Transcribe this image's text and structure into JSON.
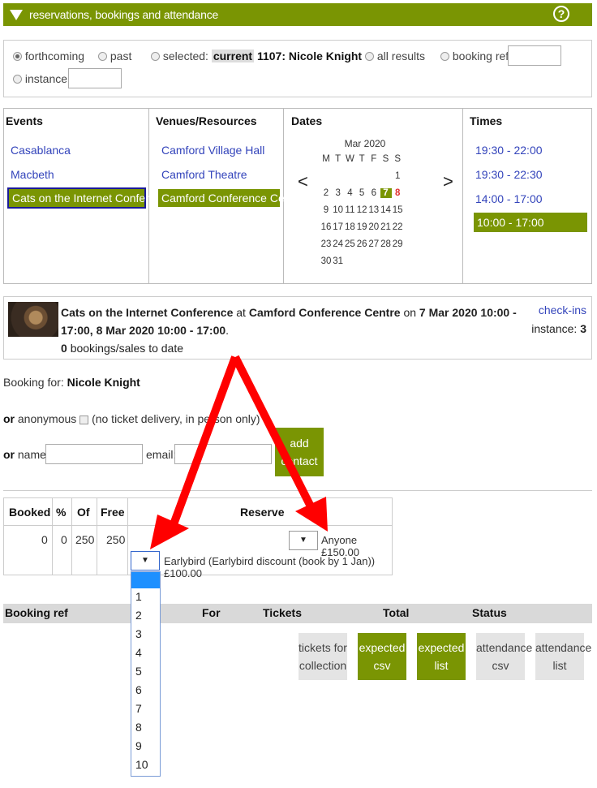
{
  "header": {
    "title": "reservations, bookings and attendance",
    "help_icon": "?"
  },
  "filter": {
    "forthcoming": "forthcoming",
    "past": "past",
    "selected": "selected:",
    "current": "current",
    "current_desc": "1107: Nicole Knight",
    "all_results": "all results",
    "booking_ref": "booking ref:",
    "instance": "instance:"
  },
  "grid": {
    "events_head": "Events",
    "events": [
      "Casablanca",
      "Macbeth",
      "Cats on the Internet Conference"
    ],
    "venues_head": "Venues/Resources",
    "venues": [
      "Camford Village Hall",
      "Camford Theatre",
      "Camford Conference Centre"
    ],
    "dates_head": "Dates",
    "calendar": {
      "month": "Mar 2020",
      "weekdays": [
        "M",
        "T",
        "W",
        "T",
        "F",
        "S",
        "S"
      ],
      "rows": [
        [
          "",
          "",
          "",
          "",
          "",
          "",
          "1"
        ],
        [
          "2",
          "3",
          "4",
          "5",
          "6",
          "7",
          "8"
        ],
        [
          "9",
          "10",
          "11",
          "12",
          "13",
          "14",
          "15"
        ],
        [
          "16",
          "17",
          "18",
          "19",
          "20",
          "21",
          "22"
        ],
        [
          "23",
          "24",
          "25",
          "26",
          "27",
          "28",
          "29"
        ],
        [
          "30",
          "31",
          "",
          "",
          "",
          "",
          ""
        ]
      ],
      "prev": "<",
      "next": ">",
      "selected_days": [
        "7",
        "8"
      ]
    },
    "times_head": "Times",
    "times": [
      "19:30 - 22:00",
      "19:30 - 22:30",
      "14:00 - 17:00",
      "10:00 - 17:00"
    ]
  },
  "event": {
    "name": "Cats on the Internet Conference",
    "at": "at",
    "venue": "Camford Conference Centre",
    "on": "on",
    "dates": "7 Mar 2020 10:00 - 17:00, 8 Mar 2020 10:00 - 17:00",
    "bookings_count": "0",
    "bookings_label": "bookings/sales to date",
    "checkins": "check-ins",
    "instance_label": "instance:",
    "instance_value": "3"
  },
  "booking": {
    "for_label": "Booking for:",
    "for_name": "Nicole Knight",
    "or": "or",
    "anonymous": "anonymous",
    "anon_note": "(no ticket delivery, in person only)",
    "name_label": "name:",
    "email_label": "email:",
    "add_contact_1": "add",
    "add_contact_2": "contact"
  },
  "reserve": {
    "headers": [
      "Booked",
      "%",
      "Of",
      "Free",
      "Reserve"
    ],
    "row": [
      "0",
      "0",
      "250",
      "250"
    ],
    "ticket1": "Anyone £150.00",
    "ticket2": "Earlybird (Earlybird discount (book by 1 Jan)) £100.00",
    "dropdown_options": [
      "",
      "1",
      "2",
      "3",
      "4",
      "5",
      "6",
      "7",
      "8",
      "9",
      "10"
    ]
  },
  "bookings": {
    "headers": [
      "Booking ref",
      "For",
      "Tickets",
      "Total",
      "Status"
    ],
    "buttons": [
      [
        "tickets for",
        "collection"
      ],
      [
        "expected",
        "csv"
      ],
      [
        "expected",
        "list"
      ],
      [
        "attendance",
        "csv"
      ],
      [
        "attendance",
        "list"
      ]
    ]
  },
  "colors": {
    "accent": "#7a9503",
    "link": "#3344bb",
    "arrow": "#ff0000",
    "highlight_day": "#e03030"
  }
}
